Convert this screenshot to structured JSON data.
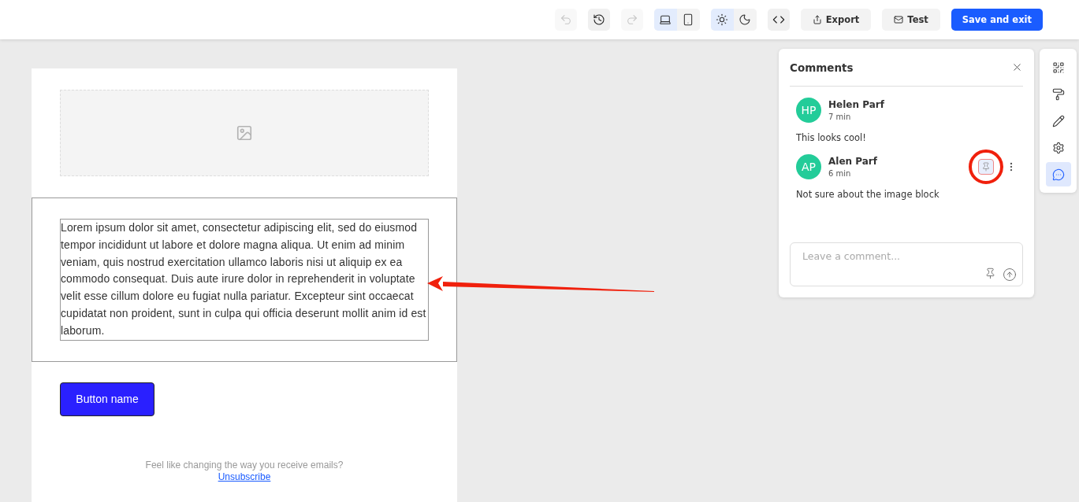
{
  "toolbar": {
    "buttons": [
      {
        "kind": "undo",
        "disabled": true
      },
      {
        "kind": "history",
        "disabled": false
      },
      {
        "kind": "redo",
        "disabled": true
      }
    ],
    "device_toggle": [
      {
        "kind": "desktop",
        "selected": true
      },
      {
        "kind": "mobile",
        "selected": false
      }
    ],
    "theme_toggle": [
      {
        "kind": "light",
        "selected": true
      },
      {
        "kind": "dark",
        "selected": false
      }
    ],
    "code_button": {
      "kind": "code"
    },
    "export_button": {
      "label": "Export"
    },
    "test_button": {
      "label": "Test"
    },
    "save_button": {
      "label": "Save and exit"
    }
  },
  "email": {
    "image": {
      "kind": "placeholder"
    },
    "text_block": {
      "text": "Lorem ipsum dolor sit amet, consectetur adipiscing elit, sed do eiusmod tempor incididunt ut labore et dolore magna aliqua. Ut enim ad minim veniam, quis nostrud exercitation ullamco laboris nisi ut aliquip ex ea commodo consequat. Duis aute irure dolor in reprehenderit in voluptate velit esse cillum dolore eu fugiat nulla pariatur. Excepteur sint occaecat cupidatat non proident, sunt in culpa qui officia deserunt mollit anim id est laborum."
    },
    "button": {
      "label": "Button name"
    },
    "footer": {
      "text": "Feel like changing the way you receive emails?",
      "link": "Unsubscribe"
    }
  },
  "comments_panel": {
    "title": "Comments",
    "comments": [
      {
        "initials": "HP",
        "author": "Helen Parf",
        "time": "7 min",
        "text": "This looks cool!",
        "show_actions": false
      },
      {
        "initials": "AP",
        "author": "Alen Parf",
        "time": "6 min",
        "text": "Not sure about the image block",
        "show_actions": true
      }
    ],
    "input": {
      "placeholder": "Leave a comment..."
    }
  },
  "side_rail": [
    {
      "kind": "qr",
      "selected": false
    },
    {
      "kind": "paint",
      "selected": false
    },
    {
      "kind": "edit",
      "selected": false
    },
    {
      "kind": "settings",
      "selected": false
    },
    {
      "kind": "comments",
      "selected": true
    }
  ]
}
